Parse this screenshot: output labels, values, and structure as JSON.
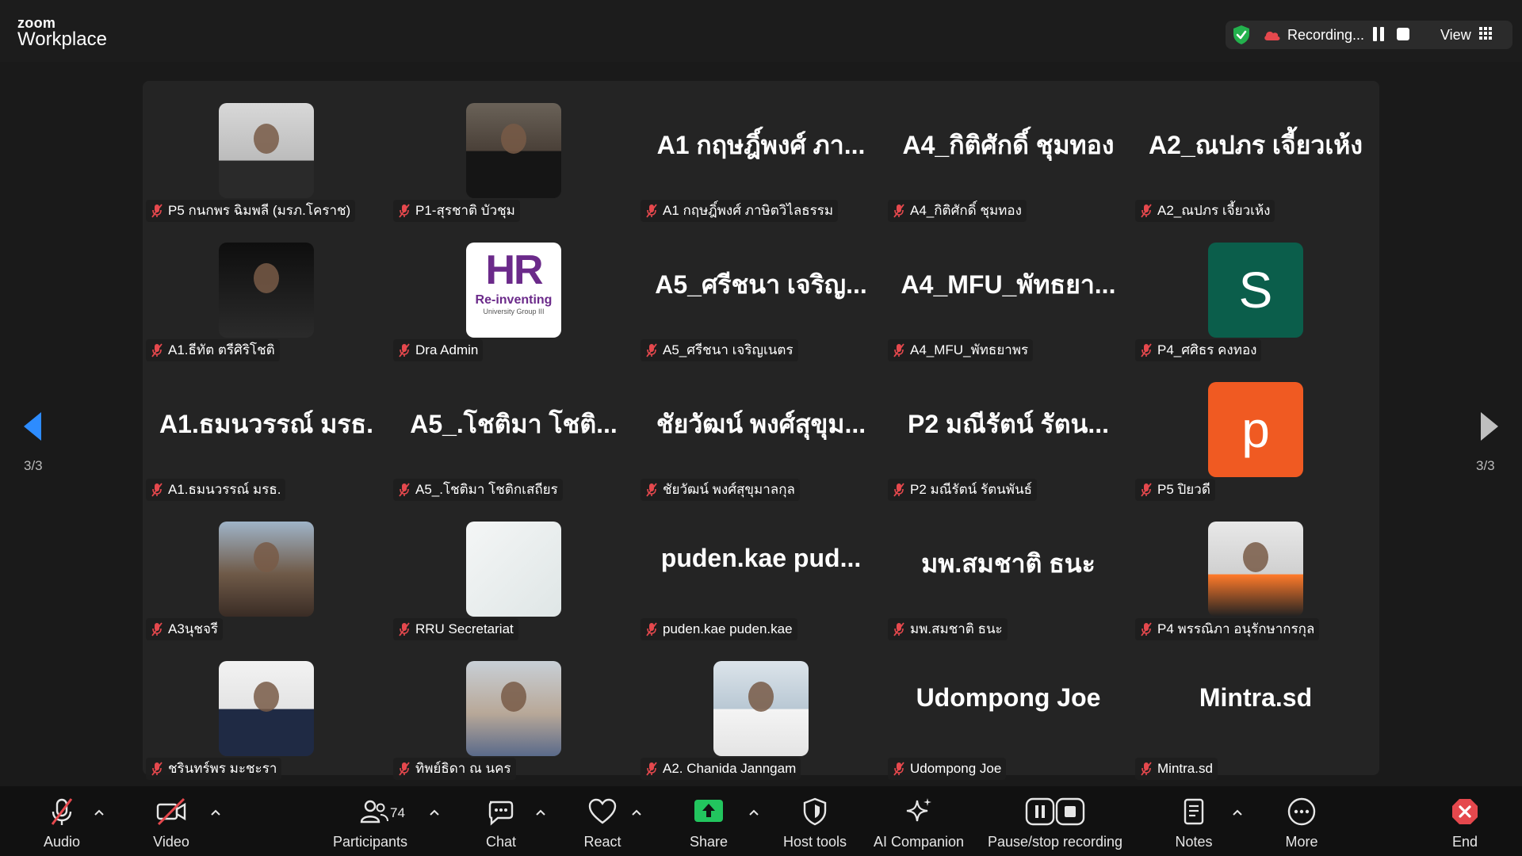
{
  "app": {
    "brand_top": "zoom",
    "brand_bottom": "Workplace"
  },
  "header": {
    "recording_label": "Recording...",
    "view_label": "View"
  },
  "pagination": {
    "left": "3/3",
    "right": "3/3"
  },
  "participants": [
    {
      "name": "P5 กนกพร ฉิมพลี (มรภ.โคราช)",
      "display": "photo",
      "big": ""
    },
    {
      "name": "P1-สุรชาติ บัวชุม",
      "display": "photo",
      "big": ""
    },
    {
      "name": "A1 กฤษฎิ์พงศ์ ภาษิตวิไลธรรม",
      "display": "text",
      "big": "A1 กฤษฎิ์พงศ์ ภา..."
    },
    {
      "name": "A4_กิติศักดิ์ ชุมทอง",
      "display": "text",
      "big": "A4_กิติศักดิ์ ชุมทอง"
    },
    {
      "name": "A2_ณปภร เจี้ยวเห้ง",
      "display": "text",
      "big": "A2_ณปภร เจี้ยวเห้ง"
    },
    {
      "name": "A1.ธีทัต ตรีศิริโชติ",
      "display": "photo",
      "big": ""
    },
    {
      "name": "Dra Admin",
      "display": "logo",
      "big": "",
      "logo_top": "HR",
      "logo_mid": "Re-inventing",
      "logo_bot": "University Group III"
    },
    {
      "name": "A5_ศรีชนา เจริญเนตร",
      "display": "text",
      "big": "A5_ศรีชนา เจริญ..."
    },
    {
      "name": "A4_MFU_พัทธยาพร",
      "display": "text",
      "big": "A4_MFU_พัทธยา..."
    },
    {
      "name": "P4_ศศิธร คงทอง",
      "display": "letter",
      "big": "S",
      "color": "#0b5e4b"
    },
    {
      "name": "A1.ธมนวรรณ์ มรธ.",
      "display": "text",
      "big": "A1.ธมนวรรณ์ มรธ."
    },
    {
      "name": "A5_.โชติมา โชติกเสถียร",
      "display": "text",
      "big": "A5_.โชติมา โชติ..."
    },
    {
      "name": "ชัยวัฒน์ พงศ์สุขุมาลกุล",
      "display": "text",
      "big": "ชัยวัฒน์ พงศ์สุขุม..."
    },
    {
      "name": "P2 มณีรัตน์ รัตนพันธ์",
      "display": "text",
      "big": "P2 มณีรัตน์ รัตน..."
    },
    {
      "name": "P5 ปิยวดี",
      "display": "letter",
      "big": "p",
      "color": "#f05a22"
    },
    {
      "name": "A3นุชจรี",
      "display": "photo",
      "big": ""
    },
    {
      "name": "RRU Secretariat",
      "display": "blank",
      "big": ""
    },
    {
      "name": "puden.kae puden.kae",
      "display": "text",
      "big": "puden.kae  pud..."
    },
    {
      "name": "มพ.สมชาติ ธนะ",
      "display": "text",
      "big": "มพ.สมชาติ ธนะ"
    },
    {
      "name": "P4 พรรณิภา อนุรักษากรกุล",
      "display": "photo",
      "big": ""
    },
    {
      "name": "ชรินทร์พร มะชะรา",
      "display": "photo",
      "big": ""
    },
    {
      "name": "ทิพย์ธิดา ณ นคร",
      "display": "photo",
      "big": ""
    },
    {
      "name": "A2. Chanida Janngam",
      "display": "photo",
      "big": ""
    },
    {
      "name": "Udompong Joe",
      "display": "text",
      "big": "Udompong Joe"
    },
    {
      "name": "Mintra.sd",
      "display": "text",
      "big": "Mintra.sd"
    }
  ],
  "toolbar": {
    "audio": "Audio",
    "video": "Video",
    "participants": "Participants",
    "participants_count": "74",
    "chat": "Chat",
    "react": "React",
    "share": "Share",
    "host_tools": "Host tools",
    "ai_companion": "AI Companion",
    "pause_stop": "Pause/stop recording",
    "notes": "Notes",
    "more": "More",
    "end": "End"
  },
  "colors": {
    "share_green": "#22c55e",
    "end_red": "#e5484d",
    "muted_red": "#e5484d",
    "nav_blue": "#2d8cff"
  }
}
